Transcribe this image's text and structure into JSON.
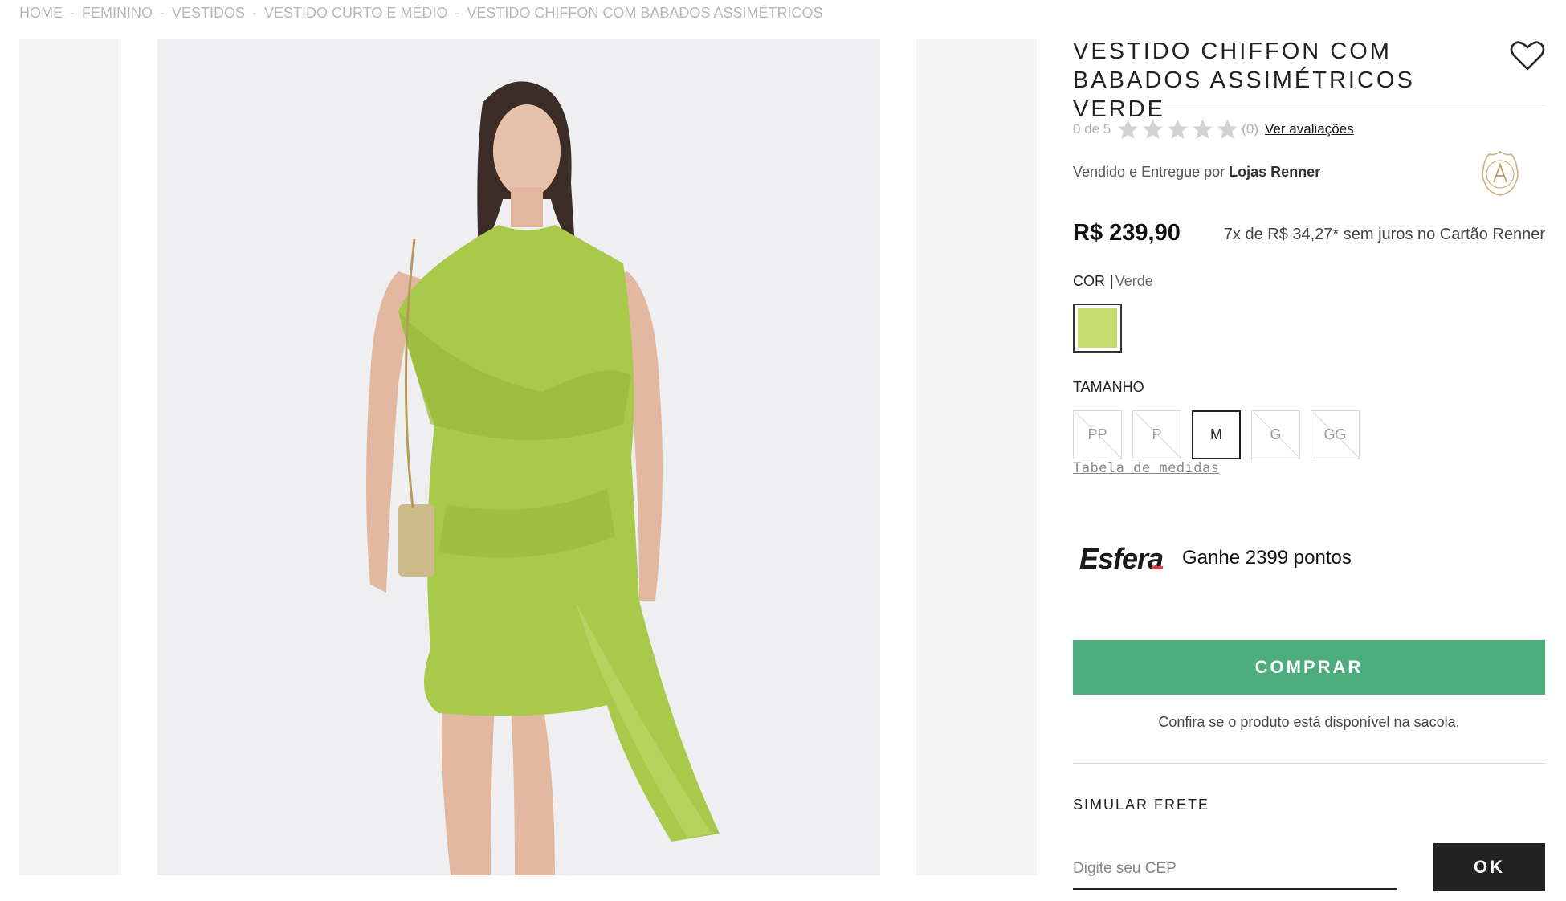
{
  "breadcrumb": [
    "HOME",
    "FEMININO",
    "VESTIDOS",
    "VESTIDO CURTO E MÉDIO",
    "VESTIDO CHIFFON COM BABADOS ASSIMÉTRICOS"
  ],
  "breadcrumb_separator": "-",
  "product": {
    "title_line1": "VESTIDO CHIFFON COM",
    "title_line2": "BABADOS ASSIMÉTRICOS VERDE",
    "rating_text": "0 de 5",
    "rating_value": 0,
    "rating_max": 5,
    "review_count": "(0)",
    "reviews_link": "Ver avaliações",
    "seller_prefix": "Vendido e Entregue por",
    "seller_name": "Lojas Renner",
    "price": "R$ 239,90",
    "installments": "7x de R$ 34,27* sem juros no Cartão Renner"
  },
  "color": {
    "label": "COR",
    "separator": "|",
    "value": "Verde",
    "swatch_hex": "#c6dc6f"
  },
  "size": {
    "label": "TAMANHO",
    "options": [
      {
        "label": "PP",
        "available": false
      },
      {
        "label": "P",
        "available": false
      },
      {
        "label": "M",
        "available": true,
        "selected": true
      },
      {
        "label": "G",
        "available": false
      },
      {
        "label": "GG",
        "available": false
      }
    ],
    "chart_link": "Tabela de medidas"
  },
  "loyalty": {
    "logo_text": "Esfera",
    "points_text": "Ganhe 2399 pontos"
  },
  "buy_button": "COMPRAR",
  "availability_note": "Confira se o produto está disponível na sacola.",
  "shipping": {
    "label": "SIMULAR FRETE",
    "cep_placeholder": "Digite seu CEP",
    "ok_button": "OK"
  },
  "colors": {
    "buy_button": "#4ead7c",
    "ok_button": "#222222",
    "dress": "#a9c94a"
  },
  "icons": [
    "heart-icon",
    "star-icon",
    "seller-badge-icon",
    "esfera-logo"
  ]
}
